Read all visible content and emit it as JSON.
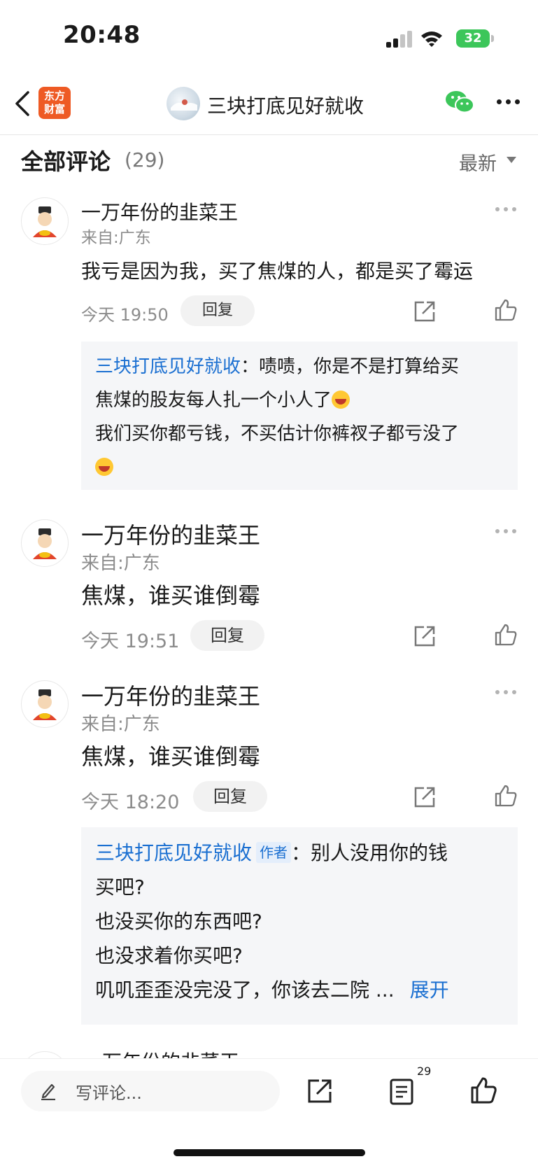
{
  "status_bar": {
    "time": "20:48",
    "battery": "32"
  },
  "nav": {
    "logo_line1": "东方",
    "logo_line2": "财富",
    "title": "三块打底见好就收"
  },
  "header": {
    "title": "全部评论",
    "count": "(29)",
    "sort": "最新"
  },
  "comments": [
    {
      "user": "一万年份的韭菜王",
      "location": "来自:广东",
      "text": "我亏是因为我，买了焦煤的人，都是买了霉运",
      "time": "今天 19:50",
      "reply_label": "回复",
      "reply": {
        "author": "三块打底见好就收",
        "separator": "：",
        "lines": [
          "啧啧，你是不是打算给买",
          "焦煤的股友每人扎一个小人了",
          "我们买你都亏钱，不买估计你裤衩子都亏没了"
        ]
      }
    },
    {
      "user": "一万年份的韭菜王",
      "location": "来自:广东",
      "text": "焦煤，谁买谁倒霉",
      "time": "今天 19:51",
      "reply_label": "回复"
    },
    {
      "user": "一万年份的韭菜王",
      "location": "来自:广东",
      "text": "焦煤，谁买谁倒霉",
      "time": "今天 18:20",
      "reply_label": "回复",
      "reply": {
        "author": "三块打底见好就收",
        "author_tag": "作者",
        "separator": "：",
        "lines": [
          "别人没用你的钱",
          "买吧?",
          "也没买你的东西吧?",
          "也没求着你买吧?",
          "叽叽歪歪没完没了，你该去二院 ..."
        ],
        "expand": "展开"
      }
    }
  ],
  "peek_user": "一万年份的韭菜王",
  "bottom_bar": {
    "input_placeholder": "写评论...",
    "comment_count": "29"
  }
}
